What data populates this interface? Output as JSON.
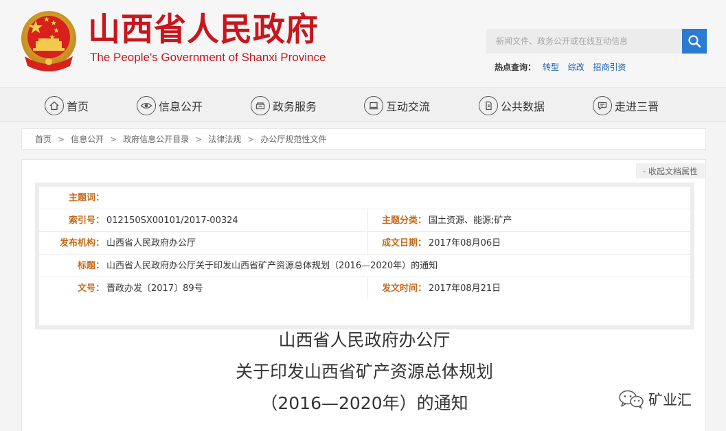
{
  "header": {
    "site_title_cn": "山西省人民政府",
    "site_title_en": "The People's Government of Shanxi Province",
    "search": {
      "placeholder": "新闻文件、政务公开或在线互动信息"
    },
    "hot_search": {
      "label": "热点查询：",
      "links": [
        "转型",
        "综改",
        "招商引资"
      ]
    }
  },
  "nav": {
    "items": [
      {
        "label": "首页",
        "icon": "home-icon"
      },
      {
        "label": "信息公开",
        "icon": "eye-icon"
      },
      {
        "label": "政务服务",
        "icon": "tray-icon"
      },
      {
        "label": "互动交流",
        "icon": "laptop-icon"
      },
      {
        "label": "公共数据",
        "icon": "data-icon"
      },
      {
        "label": "走进三晋",
        "icon": "chat-icon"
      }
    ]
  },
  "breadcrumb": [
    "首页",
    "信息公开",
    "政府信息公开目录",
    "法律法规",
    "办公厅规范性文件"
  ],
  "breadcrumb_sep": ">",
  "metadata": {
    "collapse_label": "- 收起文档属性",
    "subject_word": {
      "key": "主题词：",
      "value": ""
    },
    "index_no": {
      "key": "索引号：",
      "value": "012150SX00101/2017-00324"
    },
    "category": {
      "key": "主题分类：",
      "value": "国土资源、能源;矿产"
    },
    "issuer": {
      "key": "发布机构：",
      "value": "山西省人民政府办公厅"
    },
    "written_date": {
      "key": "成文日期：",
      "value": "2017年08月06日"
    },
    "title": {
      "key": "标题：",
      "value": "山西省人民政府办公厅关于印发山西省矿产资源总体规划（2016—2020年）的通知"
    },
    "doc_no": {
      "key": "文号：",
      "value": "晋政办发〔2017〕89号"
    },
    "publish_date": {
      "key": "发文时间：",
      "value": "2017年08月21日"
    }
  },
  "document": {
    "title_lines": [
      "山西省人民政府办公厅",
      "关于印发山西省矿产资源总体规划",
      "（2016—2020年）的通知"
    ]
  },
  "watermark": {
    "text": "矿业汇",
    "icon": "wechat-icon"
  },
  "colors": {
    "brand_red": "#c8161d",
    "search_blue": "#2b7bd1",
    "meta_key": "#c66a1a",
    "link_blue": "#1a5eb0"
  }
}
